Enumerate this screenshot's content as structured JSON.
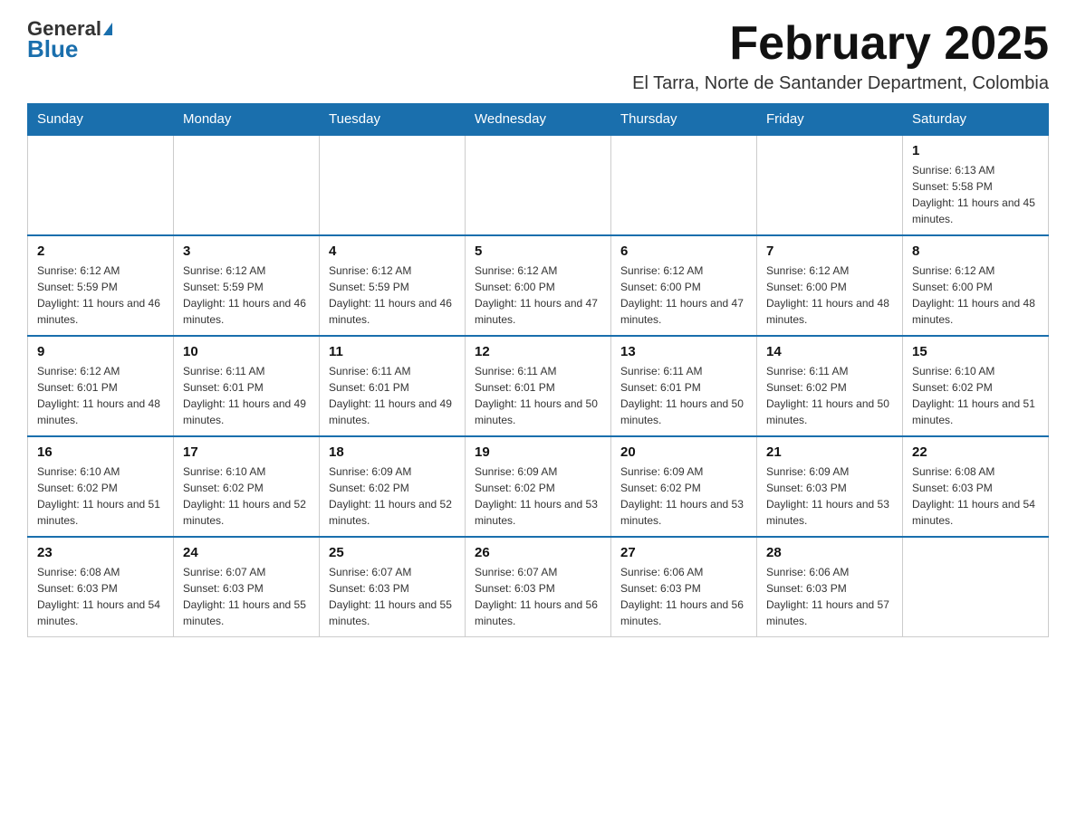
{
  "header": {
    "logo_general": "General",
    "logo_blue": "Blue",
    "month_title": "February 2025",
    "subtitle": "El Tarra, Norte de Santander Department, Colombia"
  },
  "days_of_week": [
    "Sunday",
    "Monday",
    "Tuesday",
    "Wednesday",
    "Thursday",
    "Friday",
    "Saturday"
  ],
  "weeks": [
    [
      {
        "day": "",
        "info": ""
      },
      {
        "day": "",
        "info": ""
      },
      {
        "day": "",
        "info": ""
      },
      {
        "day": "",
        "info": ""
      },
      {
        "day": "",
        "info": ""
      },
      {
        "day": "",
        "info": ""
      },
      {
        "day": "1",
        "info": "Sunrise: 6:13 AM\nSunset: 5:58 PM\nDaylight: 11 hours and 45 minutes."
      }
    ],
    [
      {
        "day": "2",
        "info": "Sunrise: 6:12 AM\nSunset: 5:59 PM\nDaylight: 11 hours and 46 minutes."
      },
      {
        "day": "3",
        "info": "Sunrise: 6:12 AM\nSunset: 5:59 PM\nDaylight: 11 hours and 46 minutes."
      },
      {
        "day": "4",
        "info": "Sunrise: 6:12 AM\nSunset: 5:59 PM\nDaylight: 11 hours and 46 minutes."
      },
      {
        "day": "5",
        "info": "Sunrise: 6:12 AM\nSunset: 6:00 PM\nDaylight: 11 hours and 47 minutes."
      },
      {
        "day": "6",
        "info": "Sunrise: 6:12 AM\nSunset: 6:00 PM\nDaylight: 11 hours and 47 minutes."
      },
      {
        "day": "7",
        "info": "Sunrise: 6:12 AM\nSunset: 6:00 PM\nDaylight: 11 hours and 48 minutes."
      },
      {
        "day": "8",
        "info": "Sunrise: 6:12 AM\nSunset: 6:00 PM\nDaylight: 11 hours and 48 minutes."
      }
    ],
    [
      {
        "day": "9",
        "info": "Sunrise: 6:12 AM\nSunset: 6:01 PM\nDaylight: 11 hours and 48 minutes."
      },
      {
        "day": "10",
        "info": "Sunrise: 6:11 AM\nSunset: 6:01 PM\nDaylight: 11 hours and 49 minutes."
      },
      {
        "day": "11",
        "info": "Sunrise: 6:11 AM\nSunset: 6:01 PM\nDaylight: 11 hours and 49 minutes."
      },
      {
        "day": "12",
        "info": "Sunrise: 6:11 AM\nSunset: 6:01 PM\nDaylight: 11 hours and 50 minutes."
      },
      {
        "day": "13",
        "info": "Sunrise: 6:11 AM\nSunset: 6:01 PM\nDaylight: 11 hours and 50 minutes."
      },
      {
        "day": "14",
        "info": "Sunrise: 6:11 AM\nSunset: 6:02 PM\nDaylight: 11 hours and 50 minutes."
      },
      {
        "day": "15",
        "info": "Sunrise: 6:10 AM\nSunset: 6:02 PM\nDaylight: 11 hours and 51 minutes."
      }
    ],
    [
      {
        "day": "16",
        "info": "Sunrise: 6:10 AM\nSunset: 6:02 PM\nDaylight: 11 hours and 51 minutes."
      },
      {
        "day": "17",
        "info": "Sunrise: 6:10 AM\nSunset: 6:02 PM\nDaylight: 11 hours and 52 minutes."
      },
      {
        "day": "18",
        "info": "Sunrise: 6:09 AM\nSunset: 6:02 PM\nDaylight: 11 hours and 52 minutes."
      },
      {
        "day": "19",
        "info": "Sunrise: 6:09 AM\nSunset: 6:02 PM\nDaylight: 11 hours and 53 minutes."
      },
      {
        "day": "20",
        "info": "Sunrise: 6:09 AM\nSunset: 6:02 PM\nDaylight: 11 hours and 53 minutes."
      },
      {
        "day": "21",
        "info": "Sunrise: 6:09 AM\nSunset: 6:03 PM\nDaylight: 11 hours and 53 minutes."
      },
      {
        "day": "22",
        "info": "Sunrise: 6:08 AM\nSunset: 6:03 PM\nDaylight: 11 hours and 54 minutes."
      }
    ],
    [
      {
        "day": "23",
        "info": "Sunrise: 6:08 AM\nSunset: 6:03 PM\nDaylight: 11 hours and 54 minutes."
      },
      {
        "day": "24",
        "info": "Sunrise: 6:07 AM\nSunset: 6:03 PM\nDaylight: 11 hours and 55 minutes."
      },
      {
        "day": "25",
        "info": "Sunrise: 6:07 AM\nSunset: 6:03 PM\nDaylight: 11 hours and 55 minutes."
      },
      {
        "day": "26",
        "info": "Sunrise: 6:07 AM\nSunset: 6:03 PM\nDaylight: 11 hours and 56 minutes."
      },
      {
        "day": "27",
        "info": "Sunrise: 6:06 AM\nSunset: 6:03 PM\nDaylight: 11 hours and 56 minutes."
      },
      {
        "day": "28",
        "info": "Sunrise: 6:06 AM\nSunset: 6:03 PM\nDaylight: 11 hours and 57 minutes."
      },
      {
        "day": "",
        "info": ""
      }
    ]
  ]
}
